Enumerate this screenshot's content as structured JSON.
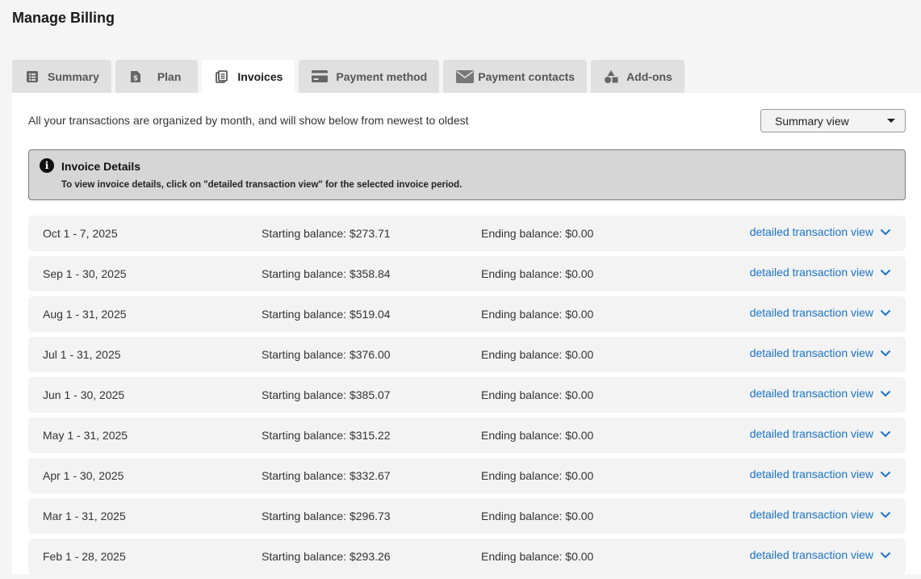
{
  "page": {
    "title": "Manage Billing"
  },
  "tabs": [
    {
      "label": "Summary",
      "icon": "summary-icon",
      "active": false
    },
    {
      "label": "Plan",
      "icon": "plan-document-icon",
      "active": false
    },
    {
      "label": "Invoices",
      "icon": "invoices-icon",
      "active": true
    },
    {
      "label": "Payment method",
      "icon": "credit-card-icon",
      "active": false
    },
    {
      "label": "Payment contacts",
      "icon": "envelope-icon",
      "active": false
    },
    {
      "label": "Add-ons",
      "icon": "shapes-icon",
      "active": false
    }
  ],
  "intro_text": "All your transactions are organized by month, and will show below from newest to oldest",
  "view_select": {
    "value": "Summary view"
  },
  "info_box": {
    "icon": "info-icon",
    "title": "Invoice Details",
    "text": "To view invoice details, click on \"detailed transaction view\" for the selected invoice period."
  },
  "invoices": [
    {
      "period": "Oct 1 - 7, 2025",
      "starting": "Starting balance: $273.71",
      "ending": "Ending balance: $0.00",
      "link": "detailed transaction view"
    },
    {
      "period": "Sep 1 - 30, 2025",
      "starting": "Starting balance: $358.84",
      "ending": "Ending balance: $0.00",
      "link": "detailed transaction view"
    },
    {
      "period": "Aug 1 - 31, 2025",
      "starting": "Starting balance: $519.04",
      "ending": "Ending balance: $0.00",
      "link": "detailed transaction view"
    },
    {
      "period": "Jul 1 - 31, 2025",
      "starting": "Starting balance: $376.00",
      "ending": "Ending balance: $0.00",
      "link": "detailed transaction view"
    },
    {
      "period": "Jun 1 - 30, 2025",
      "starting": "Starting balance: $385.07",
      "ending": "Ending balance: $0.00",
      "link": "detailed transaction view"
    },
    {
      "period": "May 1 - 31, 2025",
      "starting": "Starting balance: $315.22",
      "ending": "Ending balance: $0.00",
      "link": "detailed transaction view"
    },
    {
      "period": "Apr 1 - 30, 2025",
      "starting": "Starting balance: $332.67",
      "ending": "Ending balance: $0.00",
      "link": "detailed transaction view"
    },
    {
      "period": "Mar 1 - 31, 2025",
      "starting": "Starting balance: $296.73",
      "ending": "Ending balance: $0.00",
      "link": "detailed transaction view"
    },
    {
      "period": "Feb 1 - 28, 2025",
      "starting": "Starting balance: $293.26",
      "ending": "Ending balance: $0.00",
      "link": "detailed transaction view"
    }
  ],
  "colors": {
    "link": "#1a73c8",
    "page_bg": "#f5f5f5",
    "row_bg": "#f3f3f3",
    "info_bg": "#d6d6d6"
  }
}
